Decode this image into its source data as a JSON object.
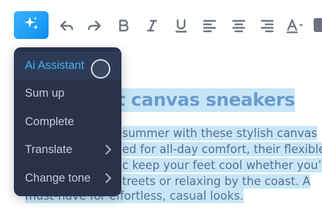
{
  "toolbar": {
    "ai_button": {
      "icon": "sparkles-icon",
      "color": "#1aa3f8"
    },
    "tools": [
      {
        "name": "undo",
        "icon": "undo-icon"
      },
      {
        "name": "redo",
        "icon": "redo-icon"
      },
      {
        "name": "bold",
        "icon": "bold-icon"
      },
      {
        "name": "italic",
        "icon": "italic-icon"
      },
      {
        "name": "underline",
        "icon": "underline-icon"
      },
      {
        "name": "align-left",
        "icon": "align-left-icon"
      },
      {
        "name": "align-center",
        "icon": "align-center-icon"
      },
      {
        "name": "align-right",
        "icon": "align-right-icon"
      },
      {
        "name": "text-color",
        "icon": "text-color-icon"
      }
    ]
  },
  "menu": {
    "items": [
      {
        "label": "Ai Assistant",
        "active": true,
        "submenu": false
      },
      {
        "label": "Sum up",
        "active": false,
        "submenu": false
      },
      {
        "label": "Complete",
        "active": false,
        "submenu": false
      },
      {
        "label": "Translate",
        "active": false,
        "submenu": true
      },
      {
        "label": "Change tone",
        "active": false,
        "submenu": true
      }
    ],
    "colors": {
      "background": "#29324a",
      "active_text": "#3fb0f5",
      "text": "#c6ccd8"
    }
  },
  "editor": {
    "heading_visible": "nt canvas sneakers",
    "paragraph_lines": [
      "summer with these stylish canvas",
      "ed for all-day comfort, their flexible",
      "c keep your feet cool whether you’re",
      "treets or relaxing by the coast. A",
      "must-have for effortless, casual looks."
    ],
    "selection_color": "#c7e6f7"
  }
}
